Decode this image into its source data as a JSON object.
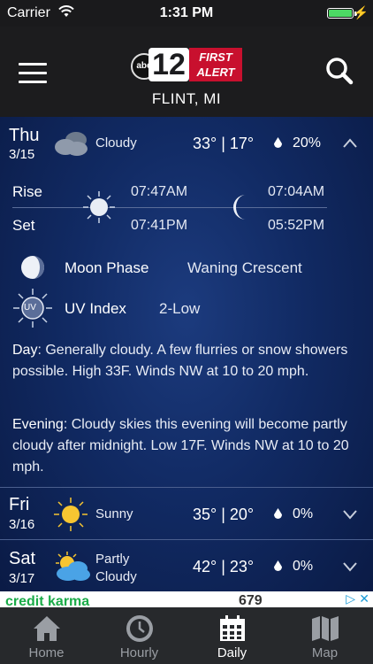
{
  "status": {
    "carrier": "Carrier",
    "time": "1:31 PM"
  },
  "header": {
    "location": "FLINT, MI",
    "logo_channel": "12",
    "logo_abc": "abc",
    "logo_line1": "FIRST",
    "logo_line2": "ALERT"
  },
  "day1": {
    "name": "Thu",
    "date": "3/15",
    "condition": "Cloudy",
    "temps": "33° | 17°",
    "precip": "20%",
    "rise_label": "Rise",
    "set_label": "Set",
    "sunrise": "07:47AM",
    "sunset": "07:41PM",
    "moonrise": "07:04AM",
    "moonset": "05:52PM",
    "moon_phase_label": "Moon Phase",
    "moon_phase": "Waning Crescent",
    "uv_label": "UV Index",
    "uv_icon_text": "UV",
    "uv": "2-Low",
    "day_label": "Day",
    "day_text": ": Generally cloudy. A few flurries or snow showers possible. High 33F. Winds NW at 10 to 20 mph.",
    "evening_label": "Evening",
    "evening_text": ": Cloudy skies this evening will become partly cloudy after midnight. Low 17F. Winds NW at 10 to 20 mph."
  },
  "day2": {
    "name": "Fri",
    "date": "3/16",
    "condition": "Sunny",
    "temps": "35° | 20°",
    "precip": "0%"
  },
  "day3": {
    "name": "Sat",
    "date": "3/17",
    "condition_line1": "Partly",
    "condition_line2": "Cloudy",
    "temps": "42° | 23°",
    "precip": "0%"
  },
  "ad": {
    "text": "credit karma",
    "number": "679"
  },
  "tabs": [
    {
      "label": "Home",
      "icon": "home-icon"
    },
    {
      "label": "Hourly",
      "icon": "clock-icon"
    },
    {
      "label": "Daily",
      "icon": "calendar-icon"
    },
    {
      "label": "Map",
      "icon": "map-icon"
    }
  ],
  "colors": {
    "accent_red": "#c8102e",
    "battery_green": "#4cd964",
    "sun_yellow": "#f7c531",
    "background_blue": "#112a63"
  }
}
